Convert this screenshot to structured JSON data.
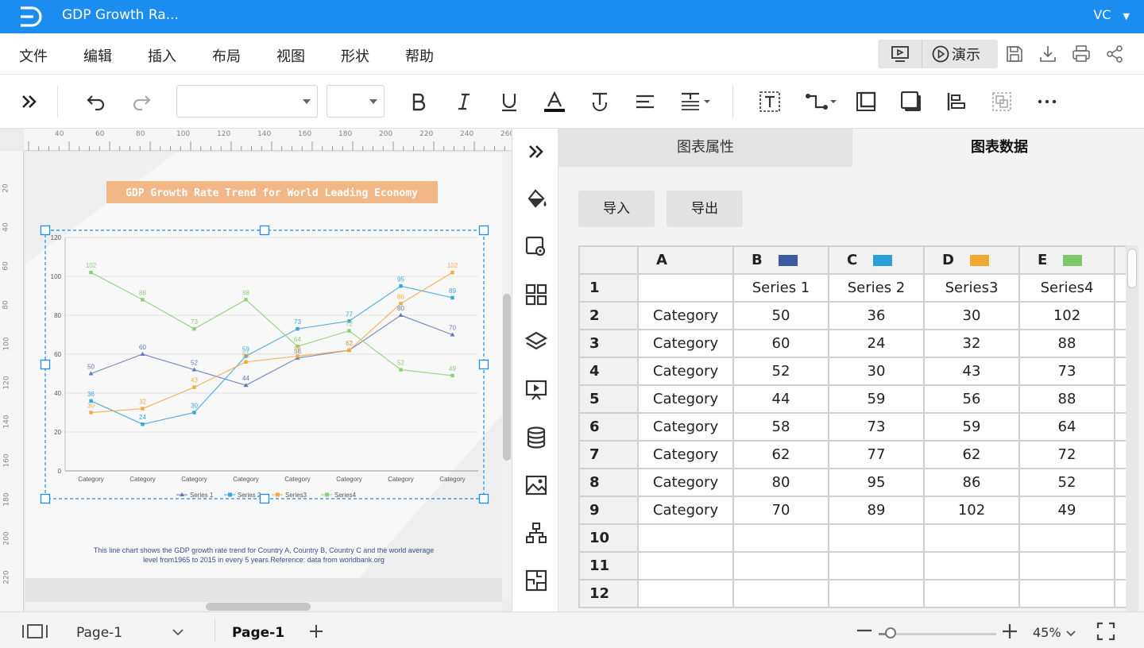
{
  "app": {
    "title": "GDP Growth Ra...",
    "user": "VC"
  },
  "menu": [
    "文件",
    "编辑",
    "插入",
    "布局",
    "视图",
    "形状",
    "帮助"
  ],
  "present_label": "演示",
  "toolbar": {
    "font_family_value": "",
    "font_size_value": ""
  },
  "ruler": {
    "h_ticks": [
      "40",
      "60",
      "80",
      "100",
      "120",
      "140",
      "160",
      "180",
      "200",
      "220",
      "240",
      "260"
    ],
    "v_ticks": [
      "20",
      "40",
      "60",
      "80",
      "100",
      "120",
      "140",
      "160",
      "180",
      "200",
      "220"
    ]
  },
  "panel": {
    "tabs": [
      "图表属性",
      "图表数据"
    ],
    "active_tab": 1,
    "import_label": "导入",
    "export_label": "导出",
    "columns": [
      {
        "letter": "A",
        "color": ""
      },
      {
        "letter": "B",
        "color": "#3f5ba8"
      },
      {
        "letter": "C",
        "color": "#2a9fd8"
      },
      {
        "letter": "D",
        "color": "#f0a830"
      },
      {
        "letter": "E",
        "color": "#7ec86a"
      }
    ],
    "rows": [
      [
        "1",
        "",
        "Series 1",
        "Series 2",
        "Series3",
        "Series4"
      ],
      [
        "2",
        "Category",
        "50",
        "36",
        "30",
        "102"
      ],
      [
        "3",
        "Category",
        "60",
        "24",
        "32",
        "88"
      ],
      [
        "4",
        "Category",
        "52",
        "30",
        "43",
        "73"
      ],
      [
        "5",
        "Category",
        "44",
        "59",
        "56",
        "88"
      ],
      [
        "6",
        "Category",
        "58",
        "73",
        "59",
        "64"
      ],
      [
        "7",
        "Category",
        "62",
        "77",
        "62",
        "72"
      ],
      [
        "8",
        "Category",
        "80",
        "95",
        "86",
        "52"
      ],
      [
        "9",
        "Category",
        "70",
        "89",
        "102",
        "49"
      ],
      [
        "10",
        "",
        "",
        "",
        "",
        ""
      ],
      [
        "11",
        "",
        "",
        "",
        "",
        ""
      ],
      [
        "12",
        "",
        "",
        "",
        "",
        ""
      ]
    ]
  },
  "caption": {
    "line1": "This line chart shows the GDP growth rate trend for Country A, Country B, Country C and the world average",
    "line2": "level from1965 to 2015 in every 5 years.Reference: data from worldbank.org"
  },
  "status": {
    "page_selector": "Page-1",
    "page_tab": "Page-1",
    "zoom": "45%",
    "zoom_fraction": 0.1
  },
  "chart_data": {
    "type": "line",
    "title": "GDP Growth Rate Trend for World Leading Economy",
    "categories": [
      "Category",
      "Category",
      "Category",
      "Category",
      "Category",
      "Category",
      "Category",
      "Category"
    ],
    "ylim": [
      0,
      120
    ],
    "yticks": [
      0,
      20,
      40,
      60,
      80,
      100,
      120
    ],
    "grid": true,
    "legend": "bottom",
    "series": [
      {
        "name": "Series 1",
        "color": "#6478b8",
        "marker": "triangle",
        "values": [
          50,
          60,
          52,
          44,
          58,
          62,
          80,
          70
        ]
      },
      {
        "name": "Series 2",
        "color": "#3aa6dc",
        "marker": "square",
        "values": [
          36,
          24,
          30,
          59,
          73,
          77,
          95,
          89
        ]
      },
      {
        "name": "Series3",
        "color": "#f2aa46",
        "marker": "square",
        "values": [
          30,
          32,
          43,
          56,
          59,
          62,
          86,
          102
        ]
      },
      {
        "name": "Series4",
        "color": "#8ccf76",
        "marker": "square",
        "values": [
          102,
          88,
          73,
          88,
          64,
          72,
          52,
          49
        ]
      }
    ]
  }
}
